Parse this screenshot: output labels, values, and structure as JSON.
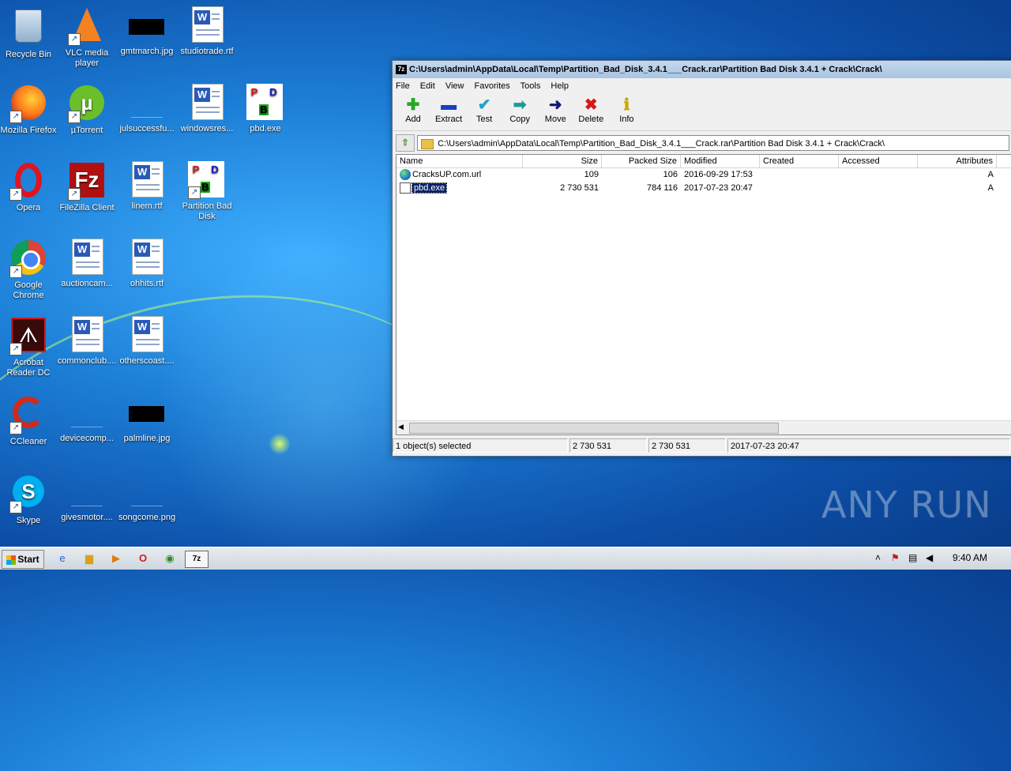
{
  "desktop": {
    "icons": [
      {
        "label": "Recycle Bin"
      },
      {
        "label": "VLC media player"
      },
      {
        "label": "gmtmarch.jpg"
      },
      {
        "label": "studiotrade.rtf"
      },
      {
        "label": "Mozilla Firefox"
      },
      {
        "label": "µTorrent"
      },
      {
        "label": "julsuccessfu..."
      },
      {
        "label": "windowsres..."
      },
      {
        "label": "pbd.exe"
      },
      {
        "label": "Opera"
      },
      {
        "label": "FileZilla Client"
      },
      {
        "label": "linem.rtf"
      },
      {
        "label": "Partition Bad Disk"
      },
      {
        "label": "Google Chrome"
      },
      {
        "label": "auctioncam..."
      },
      {
        "label": "ohhits.rtf"
      },
      {
        "label": "Acrobat Reader DC"
      },
      {
        "label": "commonclub...."
      },
      {
        "label": "otherscoast...."
      },
      {
        "label": "CCleaner"
      },
      {
        "label": "devicecomp..."
      },
      {
        "label": "palmline.jpg"
      },
      {
        "label": "Skype"
      },
      {
        "label": "givesmotor...."
      },
      {
        "label": "songcome.png"
      }
    ]
  },
  "window": {
    "title": "C:\\Users\\admin\\AppData\\Local\\Temp\\Partition_Bad_Disk_3.4.1___Crack.rar\\Partition Bad Disk 3.4.1 + Crack\\Crack\\",
    "menu": [
      "File",
      "Edit",
      "View",
      "Favorites",
      "Tools",
      "Help"
    ],
    "toolbar": [
      {
        "label": "Add",
        "icon": "plus-icon",
        "color": "#22aa22"
      },
      {
        "label": "Extract",
        "icon": "minus-icon",
        "color": "#1a3fbf"
      },
      {
        "label": "Test",
        "icon": "checkmark-icon",
        "color": "#1aa6c8"
      },
      {
        "label": "Copy",
        "icon": "double-arrow-icon",
        "color": "#1a9a9a"
      },
      {
        "label": "Move",
        "icon": "arrow-right-icon",
        "color": "#101870"
      },
      {
        "label": "Delete",
        "icon": "x-icon",
        "color": "#d41a1a"
      },
      {
        "label": "Info",
        "icon": "info-icon",
        "color": "#c8a800"
      }
    ],
    "address": "C:\\Users\\admin\\AppData\\Local\\Temp\\Partition_Bad_Disk_3.4.1___Crack.rar\\Partition Bad Disk 3.4.1 + Crack\\Crack\\",
    "columns": [
      "Name",
      "Size",
      "Packed Size",
      "Modified",
      "Created",
      "Accessed",
      "Attributes"
    ],
    "files": [
      {
        "name": "CracksUP.com.url",
        "size": "109",
        "packed": "106",
        "modified": "2016-09-29 17:53",
        "created": "",
        "accessed": "",
        "attributes": "A"
      },
      {
        "name": "pbd.exe",
        "size": "2 730 531",
        "packed": "784 116",
        "modified": "2017-07-23 20:47",
        "created": "",
        "accessed": "",
        "attributes": "A"
      }
    ],
    "status": {
      "selected": "1 object(s) selected",
      "size": "2 730 531",
      "size2": "2 730 531",
      "date": "2017-07-23 20:47"
    }
  },
  "watermark": "ANY RUN",
  "taskbar": {
    "start_label": "Start",
    "clock": "9:40 AM"
  }
}
